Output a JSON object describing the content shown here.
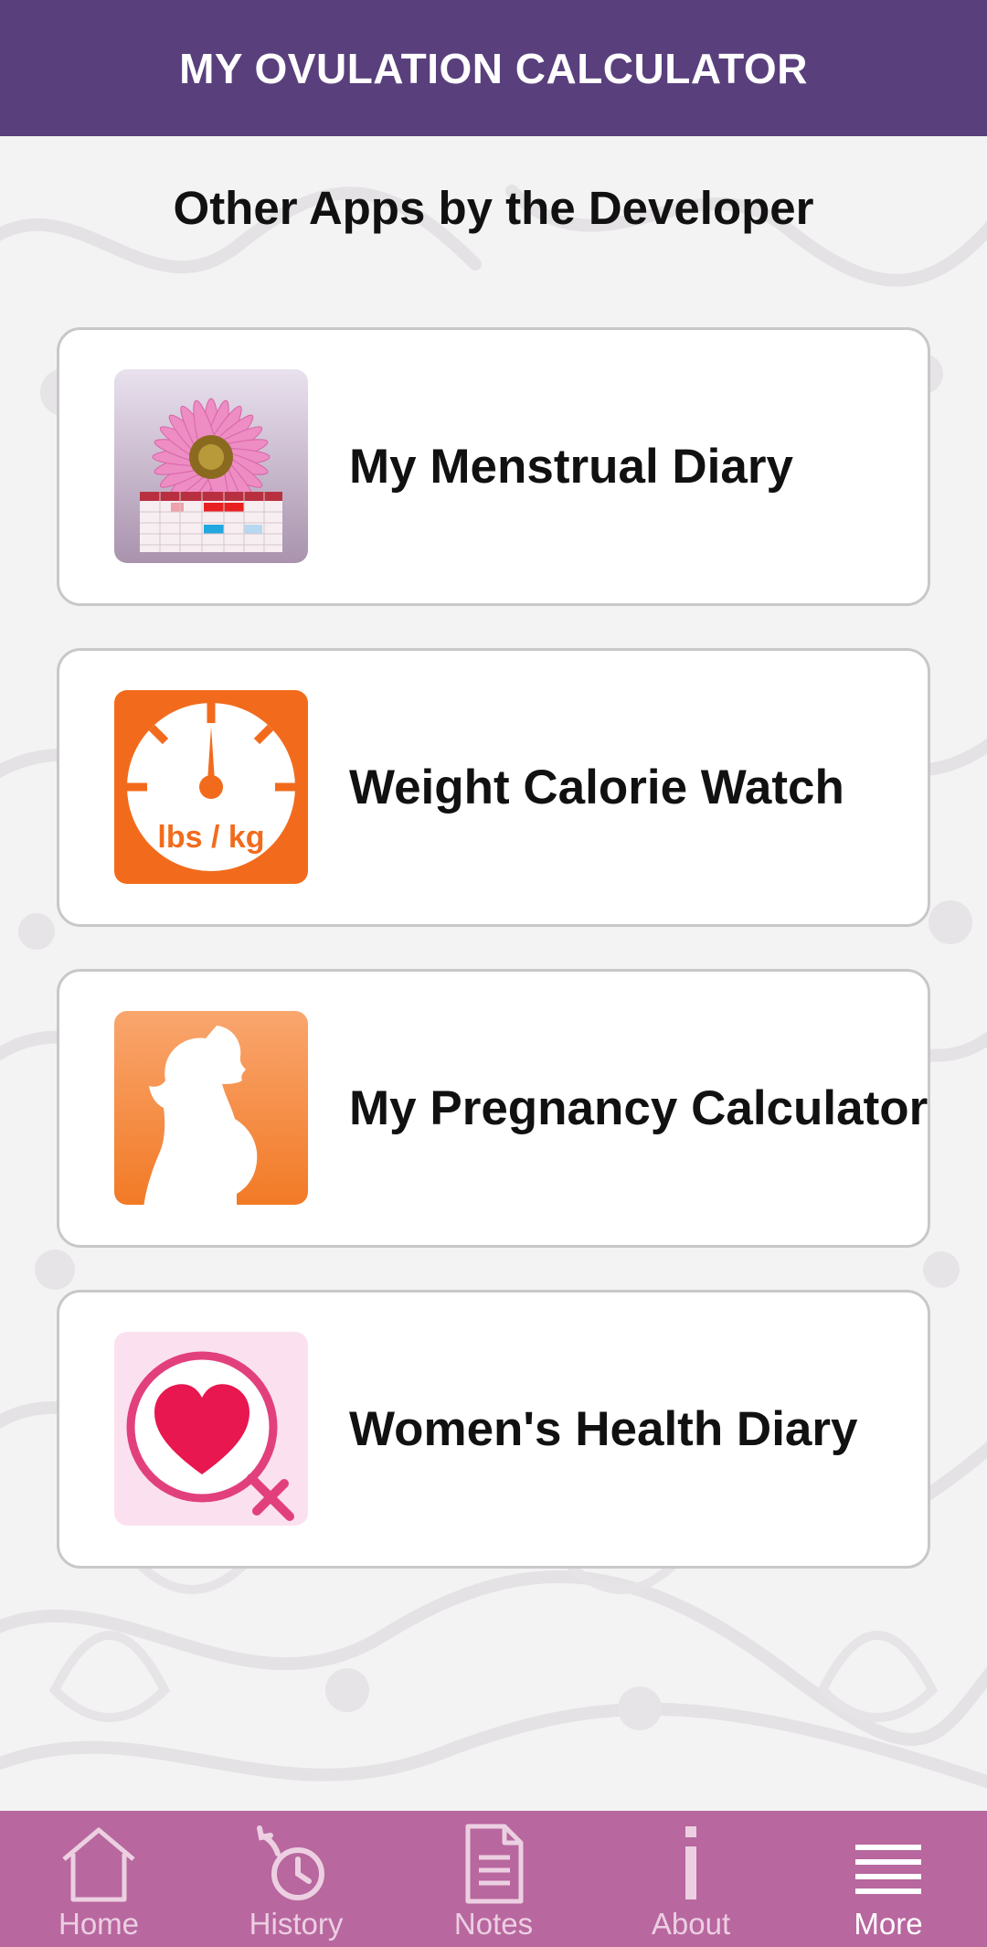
{
  "header": {
    "title": "MY OVULATION CALCULATOR"
  },
  "section": {
    "title": "Other Apps by the Developer"
  },
  "apps": [
    {
      "label": "My Menstrual Diary",
      "icon": "flower-calendar-icon"
    },
    {
      "label": "Weight Calorie Watch",
      "icon": "scale-gauge-icon",
      "icon_text": "lbs / kg"
    },
    {
      "label": "My Pregnancy Calculator",
      "icon": "pregnant-silhouette-icon"
    },
    {
      "label": "Women's Health Diary",
      "icon": "heart-female-symbol-icon"
    }
  ],
  "nav": {
    "items": [
      {
        "label": "Home",
        "icon": "home-icon",
        "active": false
      },
      {
        "label": "History",
        "icon": "history-icon",
        "active": false
      },
      {
        "label": "Notes",
        "icon": "notes-icon",
        "active": false
      },
      {
        "label": "About",
        "icon": "info-icon",
        "active": false
      },
      {
        "label": "More",
        "icon": "menu-icon",
        "active": true
      }
    ]
  },
  "colors": {
    "header_bg": "#5a3f7d",
    "nav_bg": "#b8679f",
    "orange": "#f26b1d",
    "heart": "#e8174f"
  }
}
